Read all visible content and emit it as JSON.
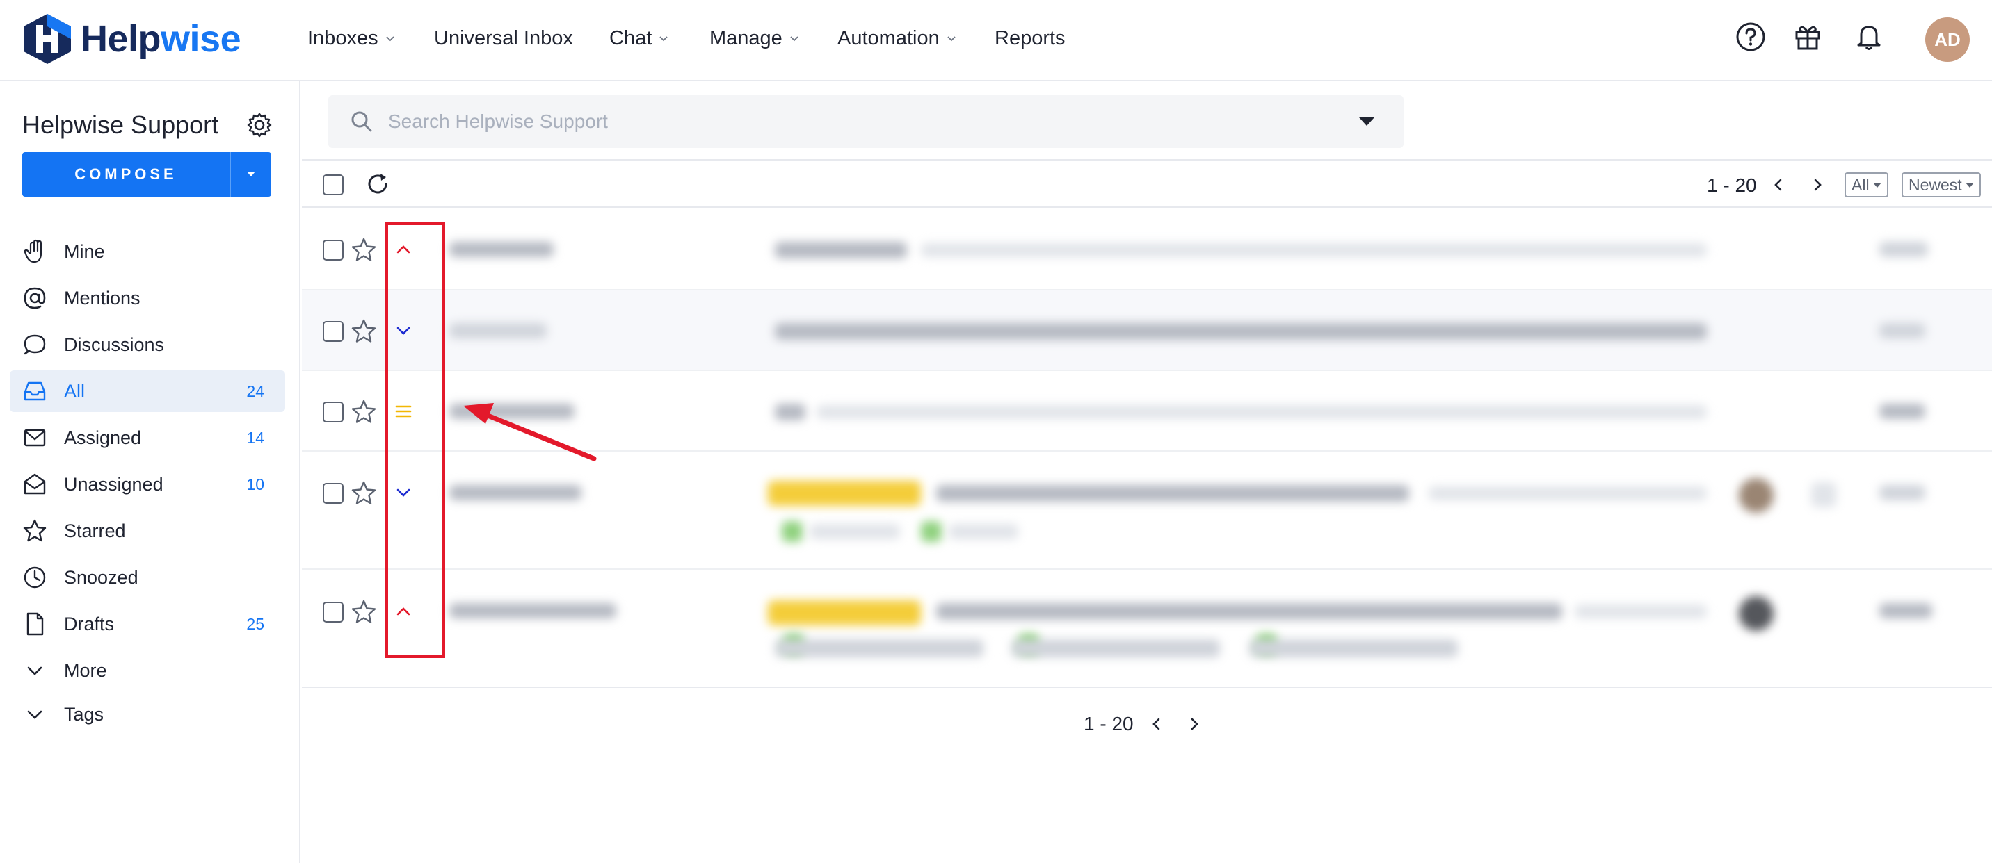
{
  "brand": {
    "name_part1": "Help",
    "name_part2": "wise",
    "icon": "helpwise-logo"
  },
  "nav": {
    "items": [
      {
        "label": "Inboxes",
        "dropdown": true
      },
      {
        "label": "Universal Inbox",
        "dropdown": false
      },
      {
        "label": "Chat",
        "dropdown": true
      },
      {
        "label": "Manage",
        "dropdown": true
      },
      {
        "label": "Automation",
        "dropdown": true
      },
      {
        "label": "Reports",
        "dropdown": false
      }
    ],
    "right_icons": [
      "help-icon",
      "gift-icon",
      "bell-icon"
    ],
    "avatar_initials": "AD",
    "avatar_color": "#c89b7f"
  },
  "sidebar": {
    "title": "Helpwise Support",
    "compose_label": "COMPOSE",
    "items": [
      {
        "label": "Mine",
        "icon": "hand-icon",
        "count": ""
      },
      {
        "label": "Mentions",
        "icon": "at-icon",
        "count": ""
      },
      {
        "label": "Discussions",
        "icon": "chat-bubble-icon",
        "count": ""
      },
      {
        "label": "All",
        "icon": "inbox-icon",
        "count": "24",
        "active": true
      },
      {
        "label": "Assigned",
        "icon": "envelope-icon",
        "count": "14"
      },
      {
        "label": "Unassigned",
        "icon": "envelope-open-icon",
        "count": "10"
      },
      {
        "label": "Starred",
        "icon": "star-icon",
        "count": ""
      },
      {
        "label": "Snoozed",
        "icon": "clock-icon",
        "count": ""
      },
      {
        "label": "Drafts",
        "icon": "file-icon",
        "count": "25"
      },
      {
        "label": "More",
        "icon": "chevron-down-icon",
        "count": ""
      },
      {
        "label": "Tags",
        "icon": "chevron-down-icon",
        "count": ""
      }
    ]
  },
  "search": {
    "placeholder": "Search Helpwise Support"
  },
  "toolbar": {
    "pager_text": "1 - 20",
    "filter_value": "All",
    "sort_value": "Newest"
  },
  "rows": [
    {
      "priority": "high",
      "priority_icon": "chevron-up-icon",
      "priority_color": "#e3192b"
    },
    {
      "priority": "low",
      "priority_icon": "chevron-down-icon",
      "priority_color": "#1c2bd1"
    },
    {
      "priority": "medium",
      "priority_icon": "equals-icon",
      "priority_color": "#f2b705"
    },
    {
      "priority": "low",
      "priority_icon": "chevron-down-icon",
      "priority_color": "#1c2bd1"
    },
    {
      "priority": "high",
      "priority_icon": "chevron-up-icon",
      "priority_color": "#e3192b"
    }
  ],
  "footer": {
    "pager_text": "1 - 20"
  },
  "annotation": {
    "color": "#e3192b"
  },
  "colors": {
    "accent": "#1474f3",
    "brand_dark": "#162a5c"
  }
}
